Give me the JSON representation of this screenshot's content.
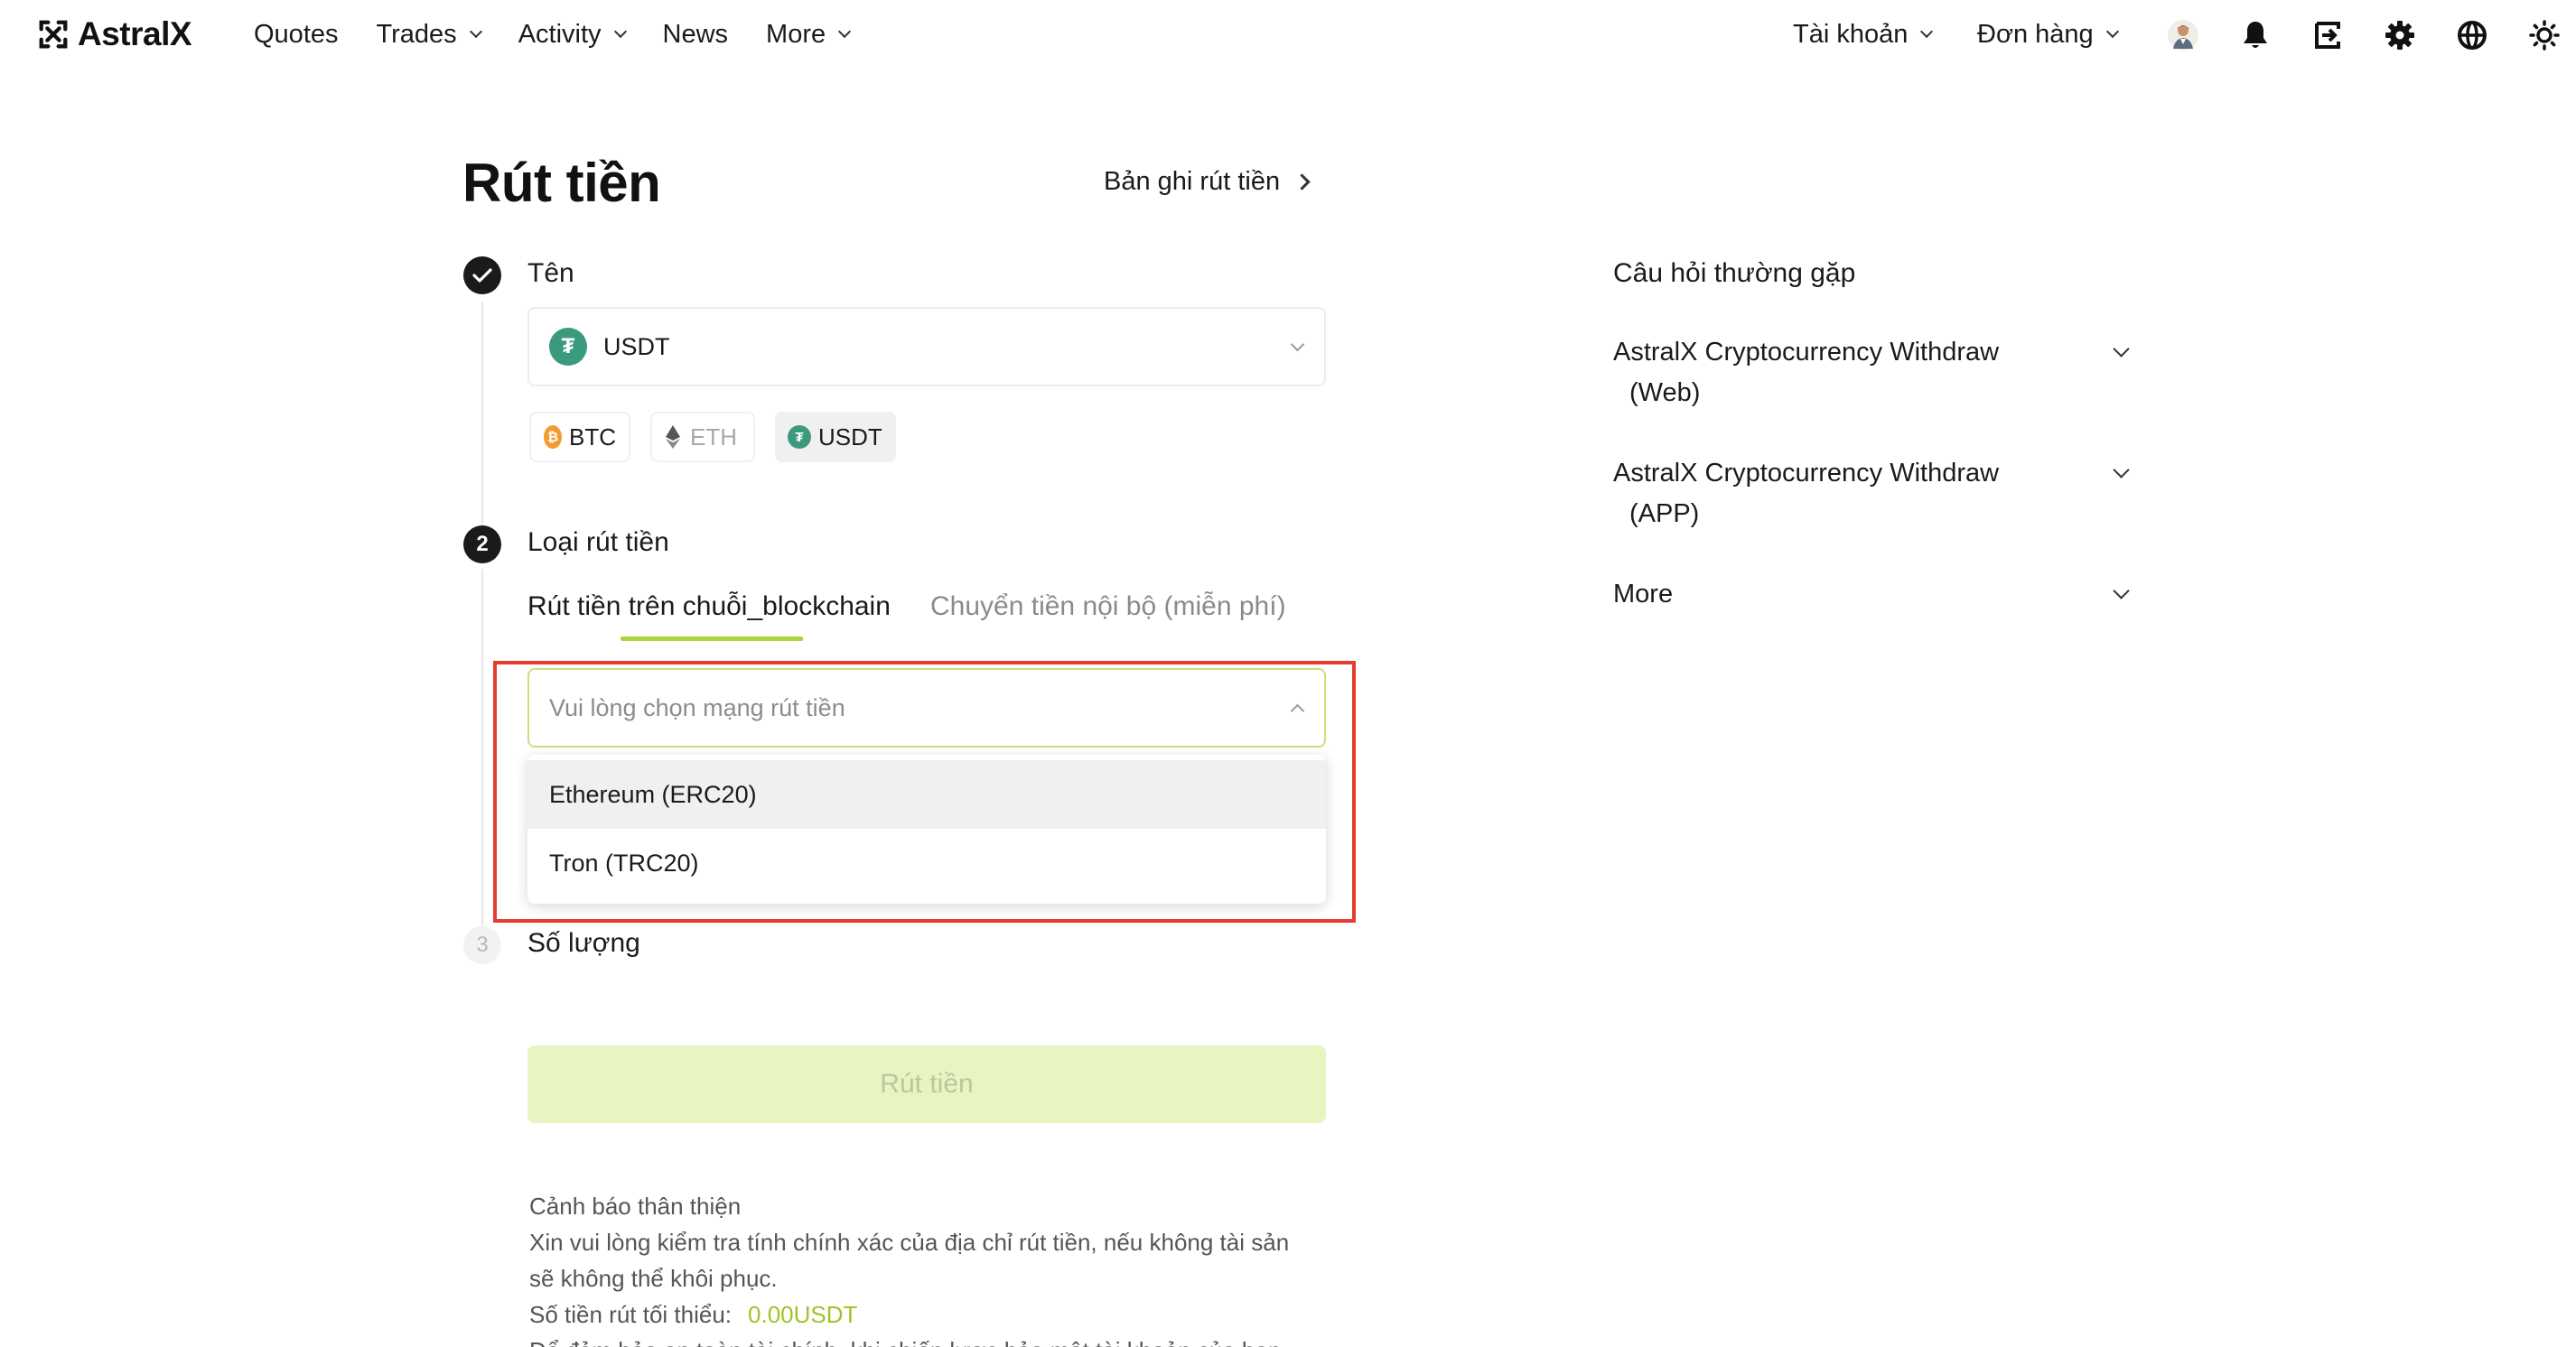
{
  "brand": {
    "name": "AstralX"
  },
  "nav": {
    "left": [
      {
        "label": "Quotes",
        "has_caret": false
      },
      {
        "label": "Trades",
        "has_caret": true
      },
      {
        "label": "Activity",
        "has_caret": true
      },
      {
        "label": "News",
        "has_caret": false
      },
      {
        "label": "More",
        "has_caret": true
      }
    ],
    "account_label": "Tài khoản",
    "orders_label": "Đơn hàng",
    "icons": [
      "avatar",
      "bell-icon",
      "download-app-icon",
      "gear-icon",
      "globe-icon",
      "theme-sun-icon"
    ]
  },
  "page": {
    "title": "Rút tiền",
    "records_link": "Bản ghi rút tiền"
  },
  "step1": {
    "label": "Tên",
    "selected_coin": "USDT",
    "chips": [
      {
        "label": "BTC",
        "icon": "bitcoin-icon",
        "style": "normal"
      },
      {
        "label": "ETH",
        "icon": "ethereum-icon",
        "style": "muted"
      },
      {
        "label": "USDT",
        "icon": "tether-icon",
        "style": "selected"
      }
    ]
  },
  "step2": {
    "number": "2",
    "label": "Loại rút tiền",
    "tabs": [
      {
        "label": "Rút tiền trên chuỗi_blockchain",
        "active": true
      },
      {
        "label": "Chuyển tiền nội bộ (miễn phí)",
        "active": false
      }
    ],
    "network_placeholder": "Vui lòng chọn mạng rút tiền",
    "network_options": [
      "Ethereum (ERC20)",
      "Tron (TRC20)"
    ]
  },
  "step3": {
    "number": "3",
    "label": "Số lượng"
  },
  "withdraw_button": "Rút tiền",
  "notes": {
    "heading": "Cảnh báo thân thiện",
    "line1": "Xin vui lòng kiểm tra tính chính xác của địa chỉ rút tiền, nếu không tài sản",
    "line2": "sẽ không thể khôi phục.",
    "min_label": "Số tiền rút tối thiểu:",
    "min_value": "0.00USDT",
    "line4": "Để đảm bảo an toàn tài chính, khi chiến lược bảo mật tài khoản của bạn"
  },
  "faq": {
    "title": "Câu hỏi thường gặp",
    "items": [
      {
        "line1": "AstralX Cryptocurrency Withdraw",
        "line2": "(Web)"
      },
      {
        "line1": "AstralX Cryptocurrency Withdraw",
        "line2": "(APP)"
      },
      {
        "line1": "More",
        "line2": ""
      }
    ]
  },
  "colors": {
    "accent_green": "#a8d63a",
    "highlight_red": "#e43d30",
    "button_bg_disabled": "#e9f5c0",
    "tether": "#3b9a7d",
    "bitcoin": "#f39b2f"
  }
}
